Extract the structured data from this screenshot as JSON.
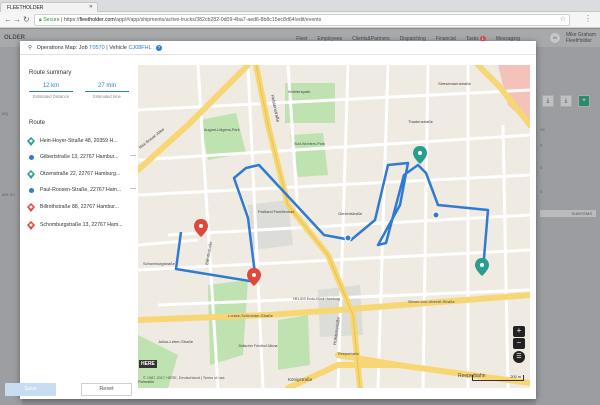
{
  "browser": {
    "tab_title": "FLEETHOLDER",
    "secure_label": "Secure",
    "url_prefix": "https://",
    "url_host": "fleetholder.com",
    "url_path": "/app/#/app/shipments/active-trucks/382cb282-0d09-4ba7-aed6-8b8c15ec8d64/edit/events"
  },
  "app": {
    "logo": "OLDER",
    "nav": {
      "fleet": "Fleet",
      "employees": "Employees",
      "clients": "Clients&Partners",
      "dispatching": "Dispatching",
      "financial": "Financial",
      "tasks": "Tasks",
      "tasks_badge": "1",
      "messaging": "Messaging"
    },
    "user_name": "Mike Graham",
    "user_role": "FleetHolder",
    "avatar_initials": "M",
    "left_items": [
      "ary",
      "are no"
    ],
    "right_items": [
      "ns",
      "5",
      "5",
      "5"
    ],
    "right_pill": "SUBITEMS"
  },
  "modal": {
    "title_label": "Operations Map:",
    "job_label": "Job",
    "job_id": "T0570",
    "separator": "|",
    "vehicle_label": "Vehicle",
    "vehicle_id": "CJ08FHL",
    "help_glyph": "?",
    "summary_title": "Route summary",
    "distance_value": "12 km",
    "distance_label": "Estimated Distance",
    "time_value": "27 min",
    "time_label": "Estimated time",
    "route_title": "Route",
    "route": [
      {
        "text": "Hein-Hoyer-Straße 48, 20359 H...",
        "marker": "teal"
      },
      {
        "text": "Gilbertstraße 13, 22767 Hambur...",
        "marker": "dot"
      },
      {
        "text": "Otzenstraße 22, 22767 Hamburg...",
        "marker": "teal"
      },
      {
        "text": "Paul-Roosen-Straße, 22767 Ham...",
        "marker": "dot"
      },
      {
        "text": "Billrothstraße 88, 22767 Hambur...",
        "marker": "red"
      },
      {
        "text": "Schomburgstraße 13, 22767 Ham...",
        "marker": "red"
      }
    ],
    "save_label": "Save",
    "reset_label": "Reset"
  },
  "map": {
    "labels": {
      "holstenstrasse": "Holstenstraße",
      "wohlerspark": "Wohlerspark",
      "august_lutgens_park": "August-Lütgens-Park",
      "sud_wohlers_park": "Süd-Wohlers-Park",
      "festland_familienbad": "Festland Familienbad",
      "gerichtstrasse": "Gerichtstraße",
      "schomburgstrasse": "Schomburgstraße",
      "billrothstrasse": "Billrothstraße",
      "louise_schroeder": "Louise-Schroeder-Straße",
      "julius_leber": "Julius-Leber-Straße",
      "konigstrasse": "Königstraße",
      "reeperbahn_road": "Reeperbahn",
      "reeperbahn_station": "Reeperbahn",
      "simon_von_utrecht": "Simon-von-Utrecht-Straße",
      "thadenstrasse": "Thadenstraße",
      "stresemannstrasse": "Stresemannstraße",
      "palmaille": "Palmaille",
      "max_brauer_allee": "Max-Brauer-Allee",
      "holstenstrasse_lower": "Holstenstraße",
      "helios": "HELIOS Endo-Klinik Hamburg",
      "jacobi_park": "Jüdischer Friedhof Altona"
    },
    "copyright": "© 1987-2017 HERE, Deutschland | Terms of use",
    "scale": "200 m",
    "here_logo": "HERE",
    "zoom_in": "+",
    "zoom_out": "−",
    "colors": {
      "route": "#2f7bd2",
      "teal_marker": "#2a9d8f",
      "red_marker": "#e0483a",
      "major_road": "#f7d774",
      "park": "#bfe3b0"
    }
  }
}
